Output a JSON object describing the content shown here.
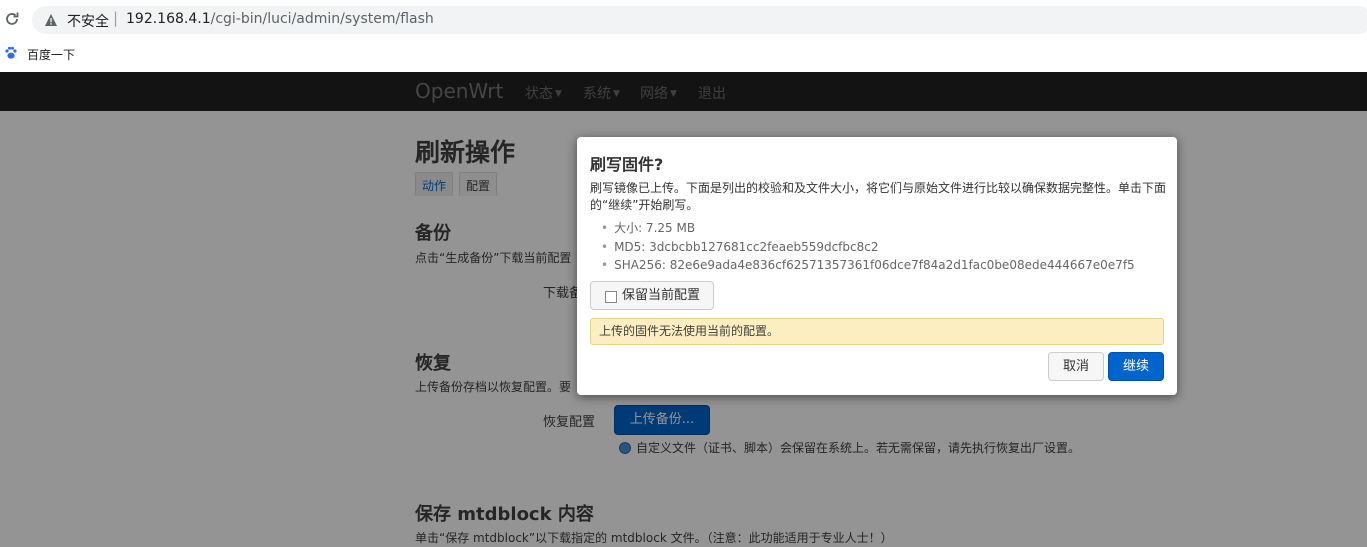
{
  "browser": {
    "insecure_label": "不安全",
    "separator": "|",
    "url_host": "192.168.4.1",
    "url_path": "/cgi-bin/luci/admin/system/flash",
    "bookmark": "百度一下"
  },
  "nav": {
    "brand": "OpenWrt",
    "items": [
      "状态",
      "系统",
      "网络",
      "退出"
    ]
  },
  "page": {
    "title": "刷新操作",
    "tabs": [
      "动作",
      "配置"
    ],
    "backup": {
      "title": "备份",
      "desc": "点击“生成备份”下载当前配置",
      "field_label": "下载备"
    },
    "restore": {
      "title": "恢复",
      "desc": "上传备份存档以恢复配置。要",
      "field_label": "恢复配置",
      "upload_button": "上传备份...",
      "hint": "自定义文件（证书、脚本）会保留在系统上。若无需保留，请先执行恢复出厂设置。"
    },
    "mtd": {
      "title": "保存 mtdblock 内容",
      "desc": "单击“保存 mtdblock”以下载指定的 mtdblock 文件。（注意：此功能适用于专业人士！）"
    }
  },
  "modal": {
    "title": "刷写固件?",
    "desc": "刷写镜像已上传。下面是列出的校验和及文件大小，将它们与原始文件进行比较以确保数据完整性。单击下面的“继续”开始刷写。",
    "checksums": [
      "大小: 7.25 MB",
      "MD5: 3dcbcbb127681cc2feaeb559dcfbc8c2",
      "SHA256: 82e6e9ada4e836cf62571357361f06dce7f84a2d1fac0be08ede444667e0e7f5"
    ],
    "keep_config_label": "保留当前配置",
    "warning": "上传的固件无法使用当前的配置。",
    "cancel_label": "取消",
    "continue_label": "继续"
  },
  "colors": {
    "primary": "#0064cd",
    "navbar": "#222222",
    "alert_bg": "#fceec1"
  }
}
